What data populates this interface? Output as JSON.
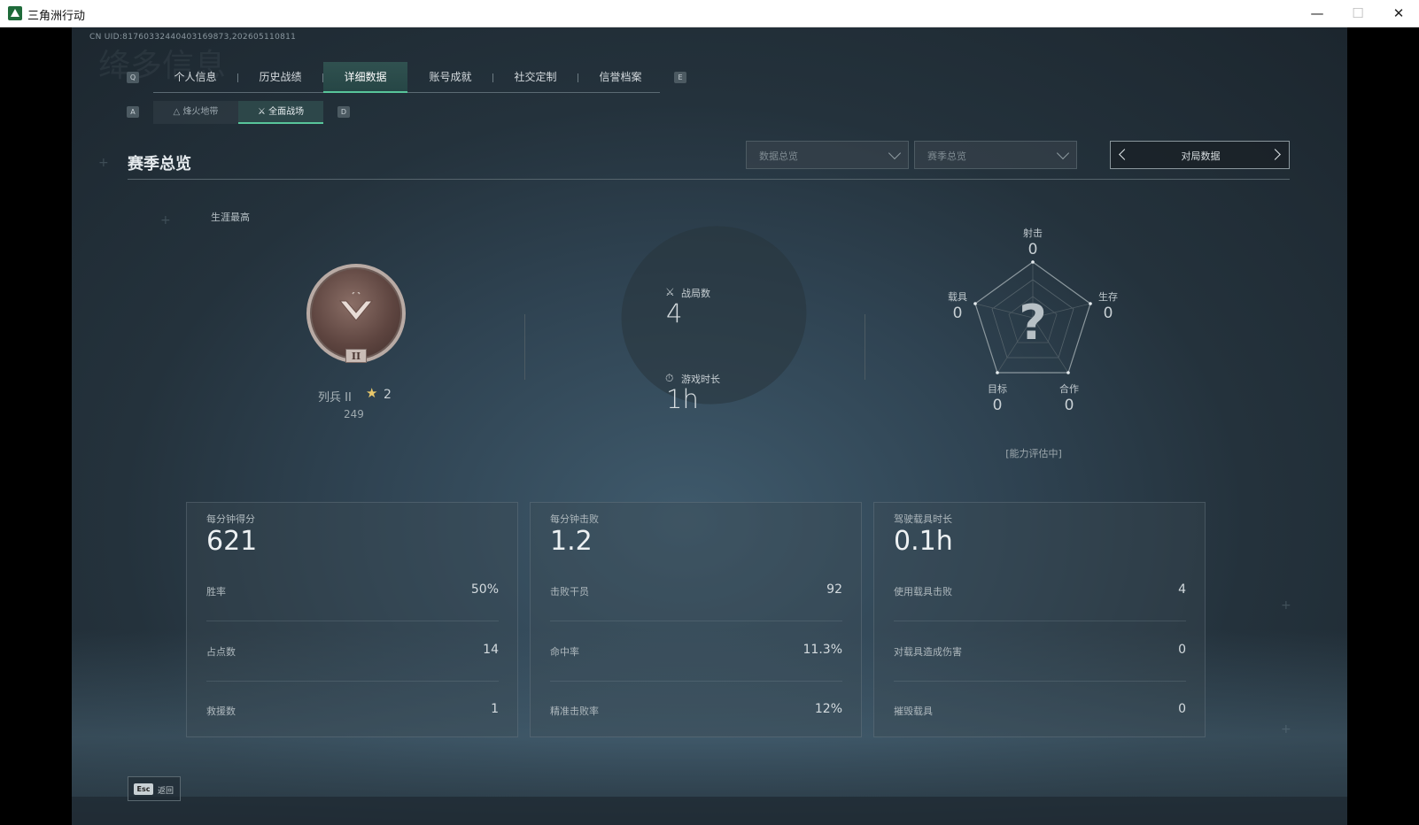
{
  "window": {
    "title": "三角洲行动",
    "min_icon": "minimize-icon",
    "max_icon": "maximize-icon",
    "close_icon": "close-icon"
  },
  "uid_text": "CN UID:81760332440403169873,202605110811",
  "ghost_text": "绛多信息",
  "tabs": {
    "prev_key": "Q",
    "next_key": "E",
    "items": [
      {
        "label": "个人信息"
      },
      {
        "label": "历史战绩"
      },
      {
        "label": "详细数据",
        "active": true
      },
      {
        "label": "账号成就"
      },
      {
        "label": "社交定制"
      },
      {
        "label": "信誉档案"
      }
    ]
  },
  "subtabs": {
    "prev_key": "A",
    "next_key": "D",
    "items": [
      {
        "label": "烽火地带",
        "icon": "mountain-icon"
      },
      {
        "label": "全面战场",
        "icon": "battlefield-icon",
        "active": true
      }
    ]
  },
  "section": {
    "title": "赛季总览"
  },
  "filters": {
    "dropdown1": "数据总览",
    "dropdown2": "赛季总览",
    "cycler": "对局数据"
  },
  "career": {
    "label": "生涯最高",
    "rank_name": "列兵 II",
    "badge_numeral": "II",
    "stars": "2",
    "score": "249"
  },
  "stats": {
    "matches_label": "战局数",
    "matches_value": "4",
    "playtime_label": "游戏时长",
    "playtime_value": "1h"
  },
  "radar": {
    "top_label": "射击",
    "top_value": "0",
    "right_label": "生存",
    "right_value": "0",
    "bottom_right_label": "合作",
    "bottom_right_value": "0",
    "bottom_left_label": "目标",
    "bottom_left_value": "0",
    "left_label": "载具",
    "left_value": "0",
    "center_glyph": "?",
    "status": "[能力评估中]"
  },
  "panels": [
    {
      "label": "每分钟得分",
      "value": "621",
      "rows": [
        {
          "label": "胜率",
          "value": "50%"
        },
        {
          "label": "占点数",
          "value": "14"
        },
        {
          "label": "救援数",
          "value": "1"
        }
      ]
    },
    {
      "label": "每分钟击败",
      "value": "1.2",
      "rows": [
        {
          "label": "击败干员",
          "value": "92"
        },
        {
          "label": "命中率",
          "value": "11.3%"
        },
        {
          "label": "精准击败率",
          "value": "12%"
        }
      ]
    },
    {
      "label": "驾驶载具时长",
      "value": "0.1h",
      "rows": [
        {
          "label": "使用载具击败",
          "value": "4"
        },
        {
          "label": "对载具造成伤害",
          "value": "0"
        },
        {
          "label": "摧毁载具",
          "value": "0"
        }
      ]
    }
  ],
  "footer": {
    "esc_key": "Esc",
    "esc_label": "返回"
  }
}
